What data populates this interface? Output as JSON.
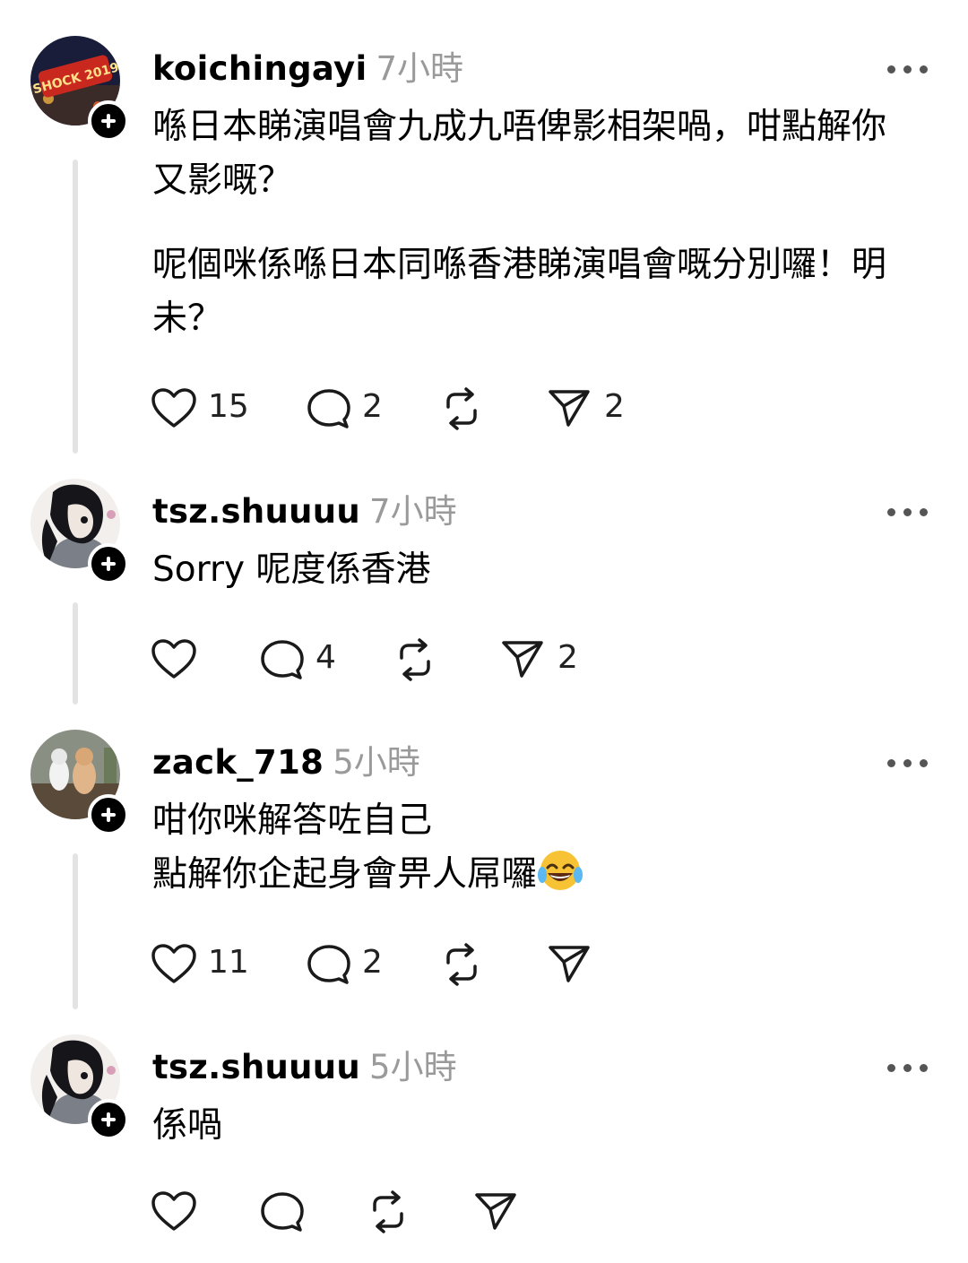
{
  "posts": [
    {
      "username": "koichingayi",
      "time": "7小時",
      "text": [
        "喺日本睇演唱會九成九唔俾影相架喎，咁點解你又影嘅？",
        "呢個咪係喺日本同喺香港睇演唱會嘅分別囉！明未？"
      ],
      "avatar_text": "SHOCK 2019",
      "likes": "15",
      "replies": "2",
      "reposts": "",
      "shares": "2"
    },
    {
      "username": "tsz.shuuuu",
      "time": "7小時",
      "text": [
        "Sorry 呢度係香港"
      ],
      "likes": "",
      "replies": "4",
      "reposts": "",
      "shares": "2"
    },
    {
      "username": "zack_718",
      "time": "5小時",
      "text": [
        "咁你咪解答咗自己",
        "點解你企起身會畀人屌囉"
      ],
      "emoji": "face-with-tears-of-joy",
      "likes": "11",
      "replies": "2",
      "reposts": "",
      "shares": ""
    },
    {
      "username": "tsz.shuuuu",
      "time": "5小時",
      "text": [
        "係喎"
      ],
      "likes": "",
      "replies": "",
      "reposts": "",
      "shares": ""
    }
  ],
  "icons": {
    "like": "heart-icon",
    "reply": "comment-icon",
    "repost": "repost-icon",
    "share": "send-icon",
    "more": "more-options-icon",
    "follow": "plus-icon"
  }
}
